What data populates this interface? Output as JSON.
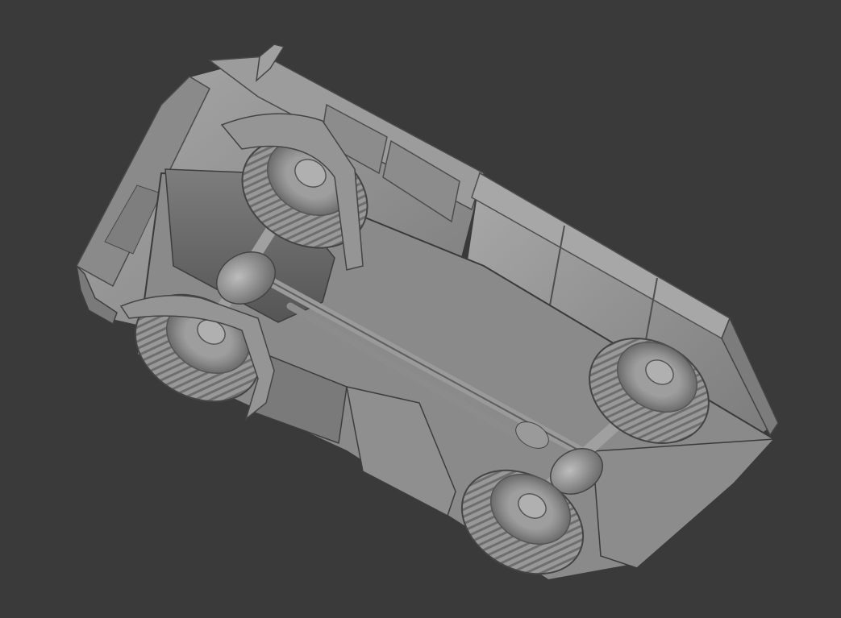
{
  "scene": {
    "subject": "truck-underside",
    "render_mode": "solid-clay",
    "colors": {
      "background": "#3a3a3a",
      "body": "#8e8e8e",
      "body_light": "#a6a6a6",
      "body_dark": "#5c5c5c",
      "tire": "#9a9a9a",
      "tire_tread": "#6f6f6f",
      "rim": "#b2b2b2",
      "outline": "#2f2f2f"
    }
  }
}
